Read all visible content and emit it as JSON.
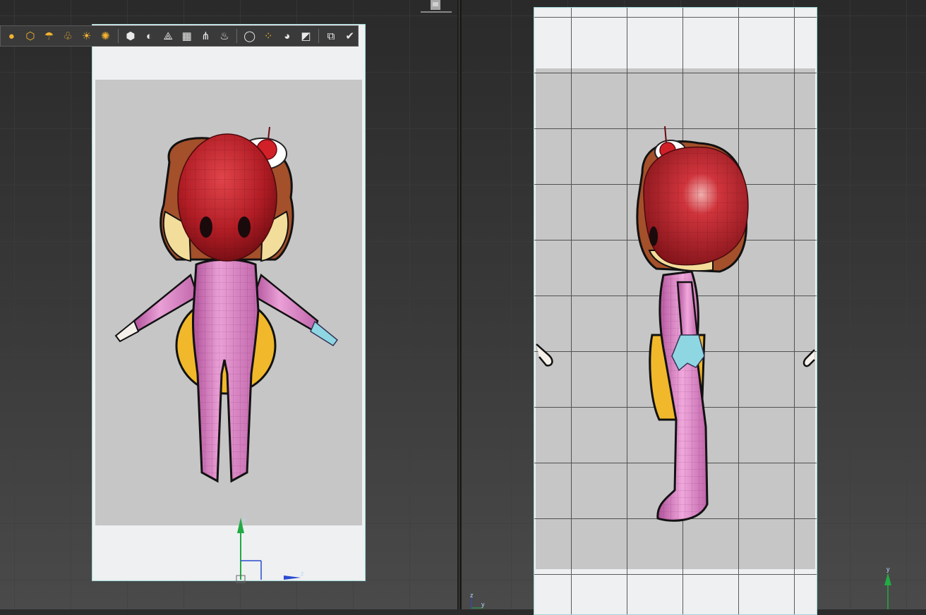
{
  "toolbar": {
    "buttons": [
      {
        "icon": "sphere-primitive-icon",
        "glyph": "●",
        "color": "yellow"
      },
      {
        "icon": "geosphere-icon",
        "glyph": "⬡",
        "color": "yellow"
      },
      {
        "icon": "omni-light-icon",
        "glyph": "☂",
        "color": "yellow"
      },
      {
        "icon": "target-spot-light-icon",
        "glyph": "♧",
        "color": "yellow"
      },
      {
        "icon": "sun-light-icon",
        "glyph": "☀",
        "color": "yellow"
      },
      {
        "icon": "sky-light-icon",
        "glyph": "✺",
        "color": "yellow"
      },
      {
        "icon": "box-mapping-icon",
        "glyph": "⬢",
        "color": "white"
      },
      {
        "icon": "material-sphere-icon",
        "glyph": "◐",
        "color": "white"
      },
      {
        "icon": "axis-tripod-icon",
        "glyph": "⟁",
        "color": "white"
      },
      {
        "icon": "render-setup-icon",
        "glyph": "▦",
        "color": "white"
      },
      {
        "icon": "hair-fur-icon",
        "glyph": "⋔",
        "color": "white"
      },
      {
        "icon": "fire-effect-icon",
        "glyph": "♨",
        "color": "white"
      },
      {
        "icon": "material-ball-icon",
        "glyph": "◯",
        "color": "white"
      },
      {
        "icon": "multi-material-icon",
        "glyph": "⁘",
        "color": "yellow"
      },
      {
        "icon": "palette-icon",
        "glyph": "◕",
        "color": "white"
      },
      {
        "icon": "material-map-icon",
        "glyph": "◩",
        "color": "white"
      },
      {
        "icon": "render-frame-icon",
        "glyph": "⧉",
        "color": "white"
      },
      {
        "icon": "render-production-icon",
        "glyph": "✔",
        "color": "white"
      }
    ]
  },
  "viewports": {
    "left": {
      "view": "front",
      "axis_labels": {
        "up": "y",
        "right": "z"
      }
    },
    "right": {
      "view": "left",
      "axis_labels": {
        "up": "y",
        "corner_a": "z",
        "corner_b": "y"
      }
    }
  },
  "colors": {
    "accent_icon": "#f2b230",
    "plane_border": "#9fd6d6",
    "head_red": "#b8202a",
    "suit_pink": "#e58fc8",
    "hair_brown": "#a4502a",
    "skin": "#f3dd9a",
    "glove_cyan": "#8fd6e3",
    "backpack_yellow": "#f0b82a",
    "axis_green": "#22aa44",
    "axis_blue": "#2a4ad0"
  }
}
